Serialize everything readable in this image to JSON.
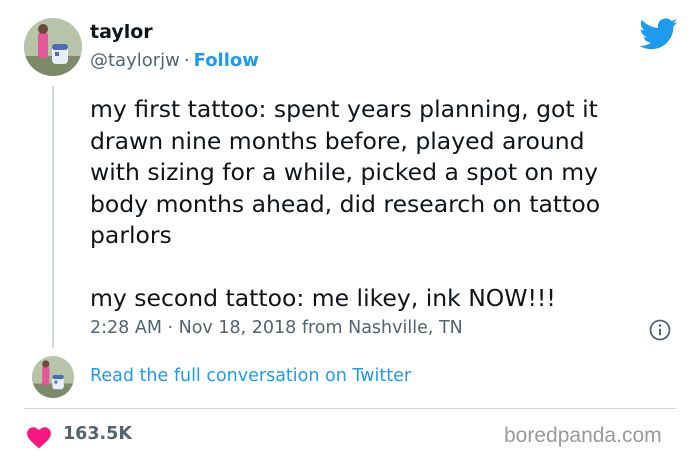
{
  "author": {
    "name": "taylor",
    "handle": "@taylorjw",
    "separator": "·",
    "follow_label": "Follow",
    "avatar_icon": "profile-photo"
  },
  "tweet": {
    "text": "my first tattoo: spent years planning, got it\ndrawn nine months before, played around\nwith sizing for a while, picked a spot on my\nbody months ahead, did research on tattoo\nparlors\n\nmy second tattoo: me likey, ink NOW!!!",
    "meta": "2:28 AM · Nov 18, 2018 from Nashville, TN"
  },
  "conversation_link": "Read the full conversation on Twitter",
  "likes": "163.5K",
  "watermark": "boredpanda.com",
  "colors": {
    "accent": "#1d9bf0",
    "heart": "#f91880",
    "text": "#0f1419",
    "secondary": "#536471"
  },
  "icons": {
    "brand": "twitter-bird-icon",
    "info": "info-icon",
    "like": "heart-icon"
  }
}
